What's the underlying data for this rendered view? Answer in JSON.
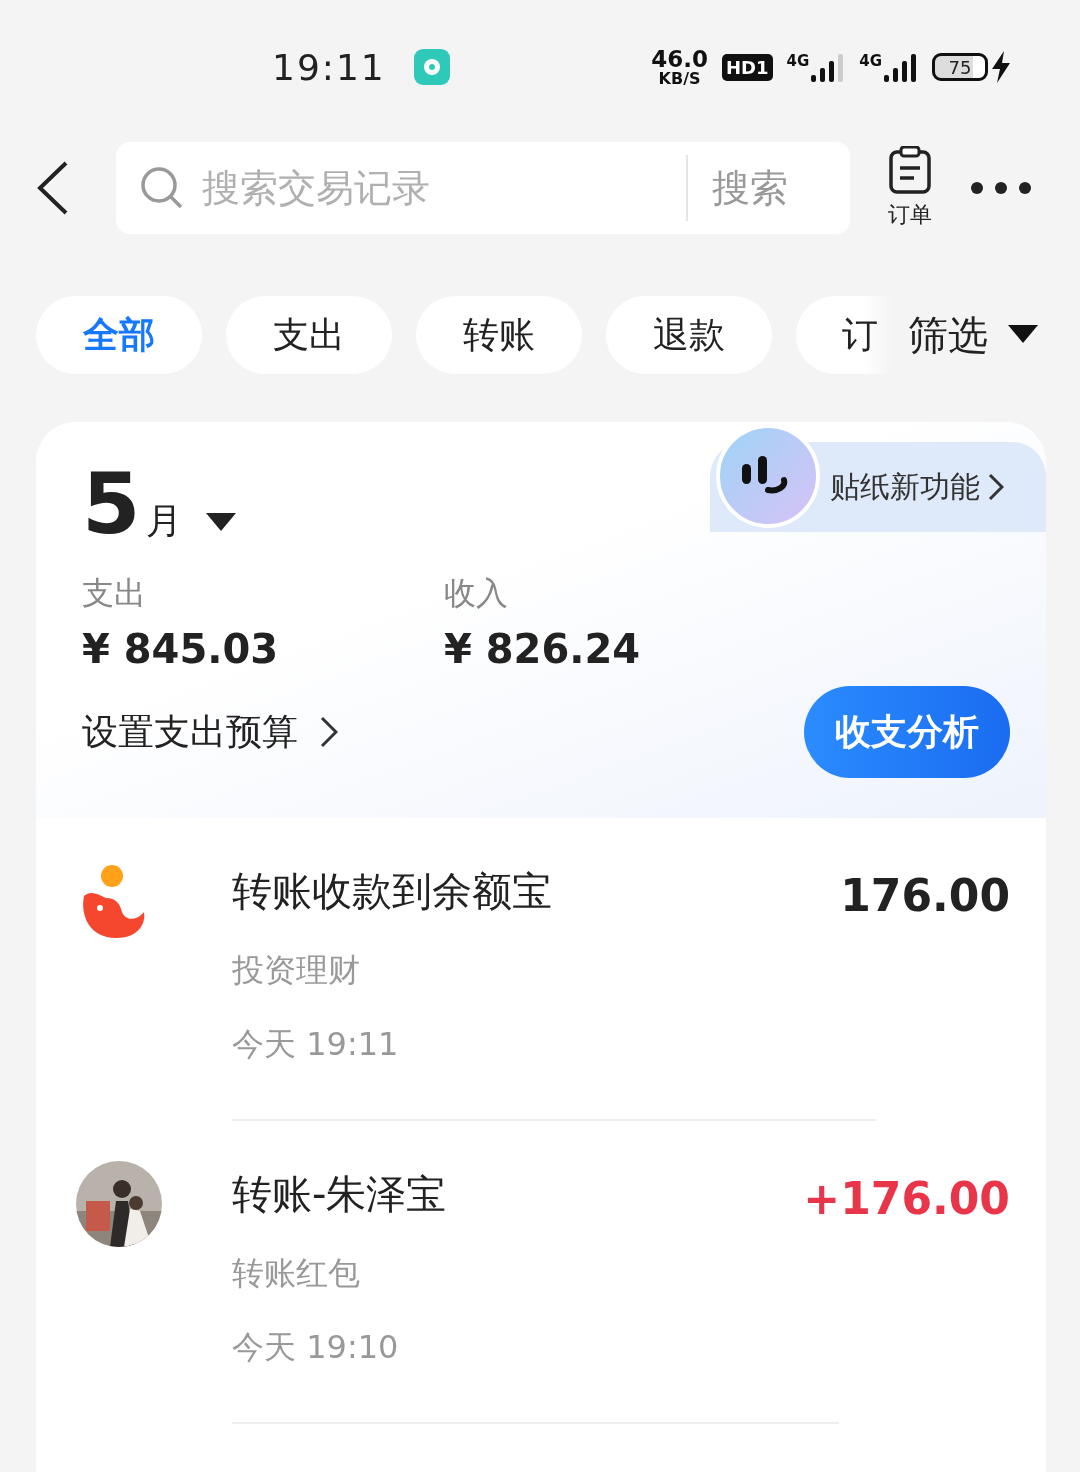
{
  "status_bar": {
    "time": "19:11",
    "speed_value": "46.0",
    "speed_unit": "KB/S",
    "hd": "HD1",
    "network_1": "4G",
    "network_2": "4G",
    "battery": "75",
    "charging": true
  },
  "header": {
    "search": {
      "placeholder": "搜索交易记录"
    },
    "search_button": "搜索",
    "orders_label": "订单"
  },
  "filters": [
    {
      "label": "全部",
      "selected": true
    },
    {
      "label": "支出",
      "selected": false
    },
    {
      "label": "转账",
      "selected": false
    },
    {
      "label": "退款",
      "selected": false
    },
    {
      "label": "订",
      "selected": false
    }
  ],
  "filter_button": "筛选",
  "sticker_banner": "贴纸新功能",
  "summary": {
    "month_number": "5",
    "month_unit": "月",
    "expense_label": "支出",
    "expense_value": "¥ 845.03",
    "income_label": "收入",
    "income_value": "¥ 826.24",
    "budget_link": "设置支出预算",
    "analysis_button": "收支分析"
  },
  "transactions": [
    {
      "kind": "app",
      "title": "转账收款到余额宝",
      "category": "投资理财",
      "time": "今天 19:11",
      "amount": "176.00",
      "income": false
    },
    {
      "kind": "avatar",
      "title": "转账-朱泽宝",
      "category": "转账红包",
      "time": "今天 19:10",
      "amount": "+176.00",
      "income": true
    }
  ]
}
